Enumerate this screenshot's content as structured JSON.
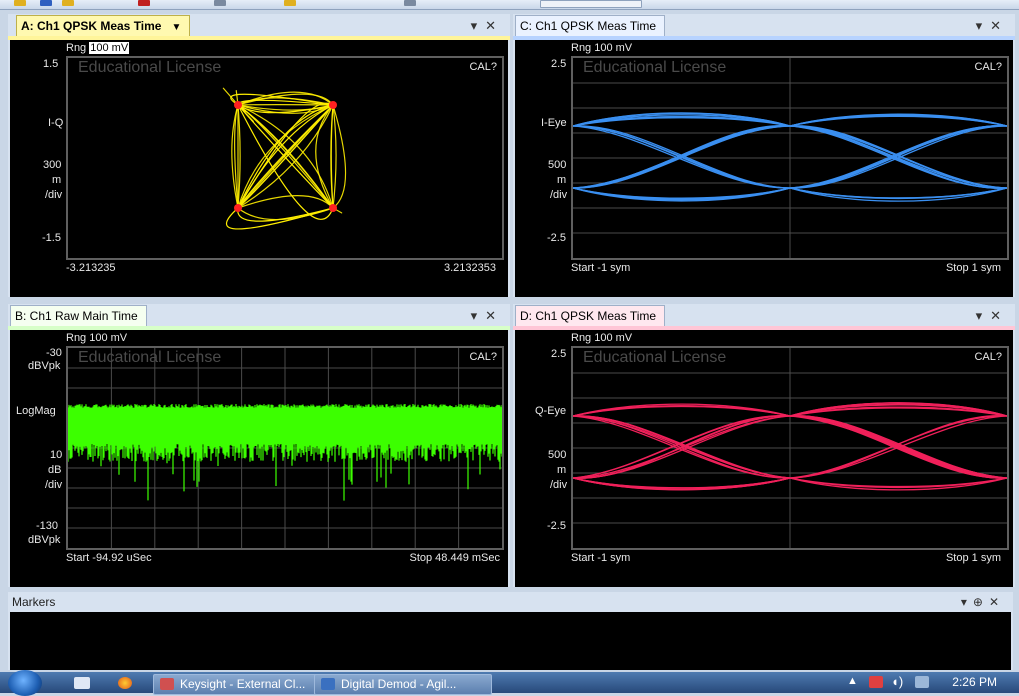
{
  "colors": {
    "trace_a": "#ffee00",
    "trace_c": "#3a8ff0",
    "trace_b": "#3cff00",
    "trace_d": "#f0205a",
    "symbol_point": "#ff2020"
  },
  "windows": {
    "a": {
      "tab_label": "A: Ch1 QPSK Meas Time",
      "dropdown_icon": "chevron-down-icon",
      "range_prefix": "Rng",
      "range_value": "100 mV",
      "watermark": "Educational License",
      "cal": "CAL?",
      "y_top": "1.5",
      "y_mid_label": "I-Q",
      "y_scale_num": "300",
      "y_scale_unit": "m",
      "y_scale_div": "/div",
      "y_bottom": "-1.5",
      "x_start": "-3.213235",
      "x_stop": "3.2132353"
    },
    "c": {
      "tab_label": "C: Ch1 QPSK Meas Time",
      "range_text": "Rng 100 mV",
      "watermark": "Educational License",
      "cal": "CAL?",
      "y_top": "2.5",
      "y_mid_label": "I-Eye",
      "y_scale_num": "500",
      "y_scale_unit": "m",
      "y_scale_div": "/div",
      "y_bottom": "-2.5",
      "x_start": "Start -1  sym",
      "x_stop": "Stop 1  sym"
    },
    "b": {
      "tab_label": "B: Ch1 Raw Main Time",
      "range_text": "Rng 100 mV",
      "watermark": "Educational License",
      "cal": "CAL?",
      "y_top": "-30",
      "y_top_unit": "dBVpk",
      "y_mid_label": "LogMag",
      "y_scale_num": "10",
      "y_scale_unit": "dB",
      "y_scale_div": "/div",
      "y_bottom": "-130",
      "y_bottom_unit": "dBVpk",
      "x_start": "Start -94.92 uSec",
      "x_stop": "Stop 48.449 mSec"
    },
    "d": {
      "tab_label": "D: Ch1 QPSK Meas Time",
      "range_text": "Rng 100 mV",
      "watermark": "Educational License",
      "cal": "CAL?",
      "y_top": "2.5",
      "y_mid_label": "Q-Eye",
      "y_scale_num": "500",
      "y_scale_unit": "m",
      "y_scale_div": "/div",
      "y_bottom": "-2.5",
      "x_start": "Start -1  sym",
      "x_stop": "Stop 1  sym"
    }
  },
  "window_controls": {
    "dropdown": "▾",
    "close": "✕",
    "pin": "⊕"
  },
  "markers_panel": {
    "title": "Markers"
  },
  "taskbar": {
    "items": [
      {
        "label": "Keysight - External Cl..."
      },
      {
        "label": "Digital Demod - Agil..."
      }
    ],
    "clock": "2:26 PM",
    "icons": [
      "windows-start-icon",
      "keyboard-icon",
      "firefox-icon",
      "app-icon",
      "demod-icon",
      "tray-up-icon",
      "flag-icon",
      "volume-icon",
      "network-icon"
    ]
  }
}
